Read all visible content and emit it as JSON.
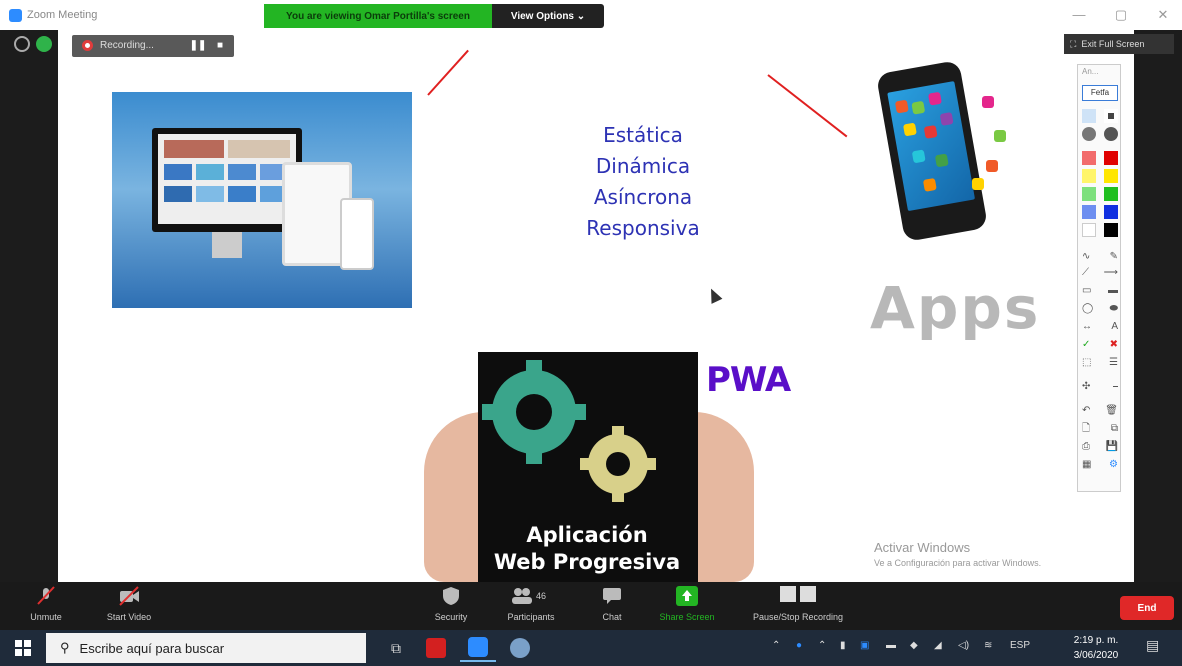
{
  "window": {
    "title": "Zoom Meeting",
    "minimize_glyph": "—",
    "maximize_glyph": "▢",
    "close_glyph": "✕"
  },
  "share_banner": {
    "viewing_text": "You are viewing Omar Portilla's screen",
    "view_options_label": "View Options ⌄"
  },
  "recording": {
    "label": "Recording...",
    "pause_glyph": "❚❚",
    "stop_glyph": "■"
  },
  "exit_full_screen_label": "Exit Full Screen",
  "slide": {
    "lines": [
      "Estática",
      "Dinámica",
      "Asíncrona",
      "Responsiva"
    ],
    "apps_text": "Apps",
    "pwa_caption_line1": "Aplicación",
    "pwa_caption_line2": "Web Progresiva",
    "pwa_logo": "PWA"
  },
  "watermark": {
    "line1": "Activar Windows",
    "line2": "Ve a Configuración para activar Windows."
  },
  "annotation_toolbar": {
    "header": "An...",
    "fill_label": "Fetfa"
  },
  "zoom_toolbar": {
    "unmute_label": "Unmute",
    "start_video_label": "Start Video",
    "security_label": "Security",
    "participants_label": "Participants",
    "participants_count": "46",
    "chat_label": "Chat",
    "share_screen_label": "Share Screen",
    "pause_stop_label": "Pause/Stop Recording",
    "end_label": "End"
  },
  "taskbar": {
    "search_placeholder": "Escribe aquí para buscar",
    "language": "ESP",
    "time": "2:19 p. m.",
    "date": "3/06/2020"
  },
  "colors": {
    "share_green": "#23b523",
    "slide_text_blue": "#2d32b4",
    "end_red": "#e02828",
    "taskbar": "#1f2b3a"
  }
}
